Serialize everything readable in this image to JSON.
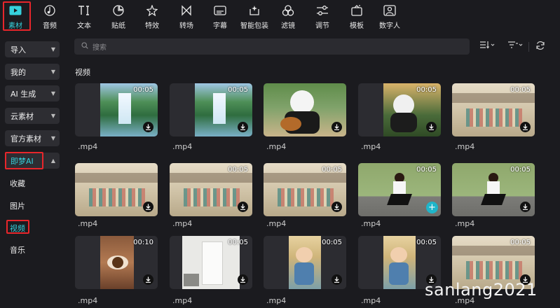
{
  "toolbar": {
    "items": [
      {
        "label": "素材",
        "icon": "media-play-icon"
      },
      {
        "label": "音频",
        "icon": "music-note-icon"
      },
      {
        "label": "文本",
        "icon": "text-ti-icon"
      },
      {
        "label": "贴纸",
        "icon": "sticker-icon"
      },
      {
        "label": "特效",
        "icon": "sparkle-star-icon"
      },
      {
        "label": "转场",
        "icon": "transition-icon"
      },
      {
        "label": "字幕",
        "icon": "subtitle-icon"
      },
      {
        "label": "智能包装",
        "icon": "smart-pack-icon"
      },
      {
        "label": "滤镜",
        "icon": "filter-icon"
      },
      {
        "label": "调节",
        "icon": "adjust-sliders-icon"
      },
      {
        "label": "模板",
        "icon": "template-icon"
      },
      {
        "label": "数字人",
        "icon": "digital-human-icon"
      }
    ],
    "active_index": 0
  },
  "sidebar": {
    "buttons": [
      {
        "label": "导入"
      },
      {
        "label": "我的"
      },
      {
        "label": "AI 生成"
      },
      {
        "label": "云素材"
      },
      {
        "label": "官方素材"
      },
      {
        "label": "即梦AI"
      }
    ],
    "sub_items": [
      {
        "label": "收藏"
      },
      {
        "label": "图片"
      },
      {
        "label": "视频"
      },
      {
        "label": "音乐"
      }
    ]
  },
  "search": {
    "placeholder": "搜索"
  },
  "section_title": "视频",
  "cards": [
    {
      "duration": "00:05",
      "name": ".mp4",
      "action": "download",
      "scene": "waterfall"
    },
    {
      "duration": "00:05",
      "name": ".mp4",
      "action": "download",
      "scene": "waterfall"
    },
    {
      "duration": "",
      "name": ".mp4",
      "action": "download",
      "scene": "panda-guitar"
    },
    {
      "duration": "00:05",
      "name": ".mp4",
      "action": "download",
      "scene": "panda-forest"
    },
    {
      "duration": "00:05",
      "name": ".mp4",
      "action": "download",
      "scene": "ancient-courtyard"
    },
    {
      "duration": "",
      "name": ".mp4",
      "action": "download",
      "scene": "ancient-courtyard"
    },
    {
      "duration": "00:05",
      "name": ".mp4",
      "action": "download",
      "scene": "ancient-courtyard"
    },
    {
      "duration": "00:05",
      "name": ".mp4",
      "action": "download",
      "scene": "ancient-courtyard"
    },
    {
      "duration": "00:05",
      "name": ".mp4",
      "action": "add",
      "scene": "runner"
    },
    {
      "duration": "00:05",
      "name": ".mp4",
      "action": "download",
      "scene": "runner"
    },
    {
      "duration": "00:10",
      "name": ".mp4",
      "action": "download",
      "scene": "eye"
    },
    {
      "duration": "00:05",
      "name": ".mp4",
      "action": "download",
      "scene": "white-door"
    },
    {
      "duration": "00:05",
      "name": ".mp4",
      "action": "download",
      "scene": "cartoon-child"
    },
    {
      "duration": "00:05",
      "name": ".mp4",
      "action": "download",
      "scene": "cartoon-child"
    },
    {
      "duration": "00:05",
      "name": ".mp4",
      "action": "download",
      "scene": "ancient-courtyard"
    }
  ],
  "watermark": "sanlang2021",
  "colors": {
    "accent": "#36d1dc",
    "highlight_box": "#e8262b",
    "background": "#1b1b1f",
    "add_button": "#1fb5c9"
  }
}
